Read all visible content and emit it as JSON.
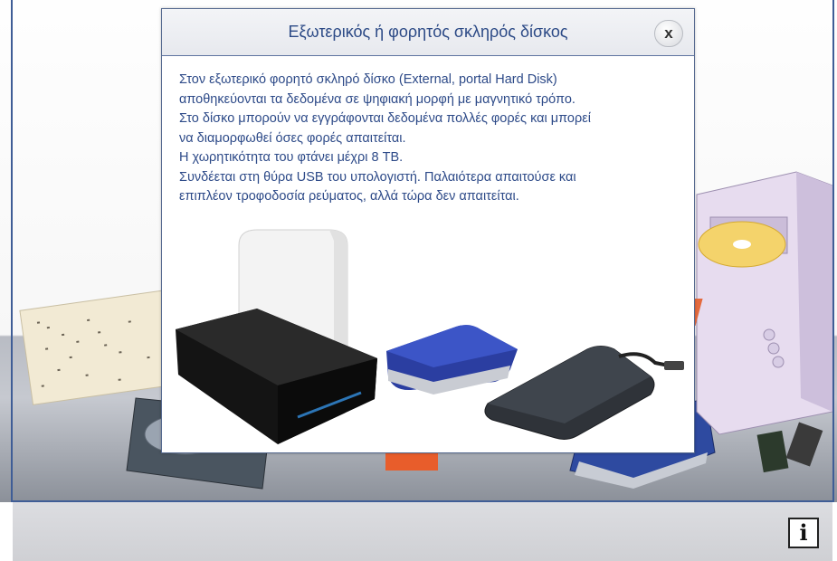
{
  "modal": {
    "title": "Εξωτερικός ή φορητός σκληρός δίσκος",
    "close_label": "x",
    "paragraphs": [
      "Στον εξωτερικό φορητό σκληρό δίσκο (External, portal Hard Disk)",
      "αποθηκεύονται τα δεδομένα σε ψηφιακή μορφή με μαγνητικό τρόπο.",
      "Στο δίσκο μπορούν να εγγράφονται δεδομένα πολλές φορές και μπορεί",
      "να διαμορφωθεί όσες φορές απαιτείται.",
      "Η χωρητικότητα του φτάνει μέχρι 8 TB.",
      "Συνδέεται στη θύρα USB του υπολογιστή. Παλαιότερα απαιτούσε και",
      "επιπλέον τροφοδοσία ρεύματος, αλλά τώρα δεν απαιτείται."
    ],
    "image_icon": "external-hard-drives-illustration"
  },
  "toolbar": {
    "info_label": "i"
  },
  "colors": {
    "accent": "#2c4a86",
    "frame": "#3f5d96",
    "header_bg": "#eceef2",
    "text": "#2d4a88"
  }
}
